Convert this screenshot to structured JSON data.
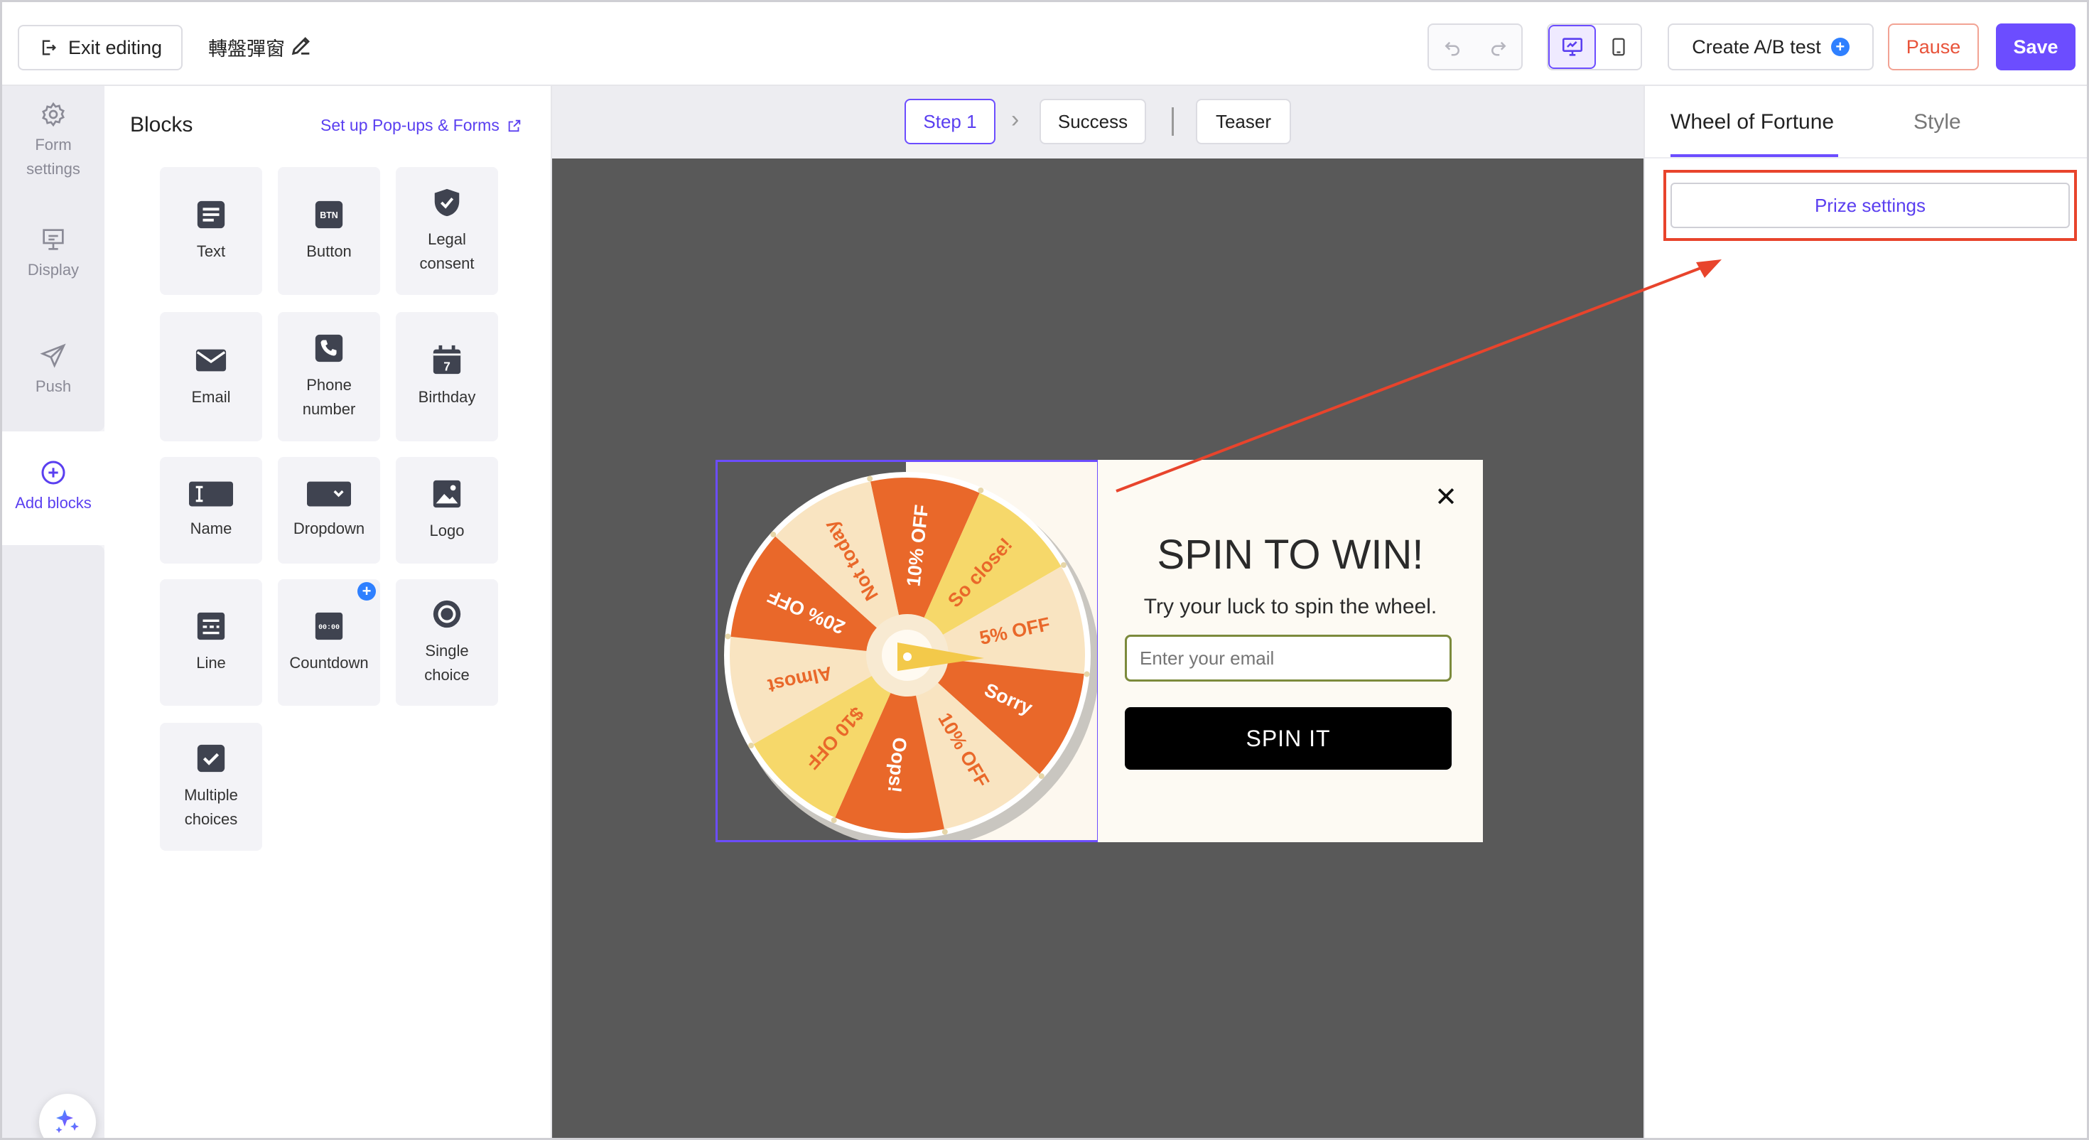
{
  "topbar": {
    "exit_label": "Exit editing",
    "form_name": "轉盤彈窗",
    "ab_test_label": "Create A/B test",
    "ab_plus": "+",
    "pause_label": "Pause",
    "save_label": "Save"
  },
  "rail": {
    "items": [
      {
        "label_line1": "Form",
        "label_line2": "settings",
        "icon": "gear-icon"
      },
      {
        "label": "Display",
        "icon": "display-icon"
      },
      {
        "label": "Push",
        "icon": "send-icon"
      },
      {
        "label": "Add blocks",
        "icon": "plus-circle-icon"
      }
    ]
  },
  "blocks": {
    "title": "Blocks",
    "setup_link": "Set up Pop-ups & Forms",
    "items": [
      {
        "label": "Text",
        "icon": "text-icon"
      },
      {
        "label": "Button",
        "icon": "button-icon",
        "icon_text": "BTN"
      },
      {
        "label_line1": "Legal",
        "label_line2": "consent",
        "icon": "shield-icon"
      },
      {
        "label": "Email",
        "icon": "email-icon"
      },
      {
        "label_line1": "Phone",
        "label_line2": "number",
        "icon": "phone-icon"
      },
      {
        "label": "Birthday",
        "icon": "calendar-icon",
        "icon_text": "7"
      },
      {
        "label": "Name",
        "icon": "name-icon"
      },
      {
        "label": "Dropdown",
        "icon": "dropdown-icon"
      },
      {
        "label": "Logo",
        "icon": "image-icon"
      },
      {
        "label": "Line",
        "icon": "line-icon"
      },
      {
        "label": "Countdown",
        "icon": "countdown-icon",
        "icon_text": "00:00",
        "badge": "+"
      },
      {
        "label_line1": "Single",
        "label_line2": "choice",
        "icon": "radio-icon"
      },
      {
        "label_line1": "Multiple",
        "label_line2": "choices",
        "icon": "checkbox-icon"
      }
    ]
  },
  "steps": {
    "step1": "Step 1",
    "chevron": "›",
    "success": "Success",
    "teaser": "Teaser"
  },
  "popup": {
    "title": "SPIN TO WIN!",
    "subtitle": "Try your luck to spin the wheel.",
    "email_placeholder": "Enter your email",
    "spin_label": "SPIN IT",
    "close": "✕",
    "segments": [
      "10% OFF",
      "So close!",
      "5% OFF",
      "Sorry",
      "10% OFF",
      "Oops!",
      "$10 OFF",
      "Almost",
      "20% OFF",
      "Not today"
    ]
  },
  "right_panel": {
    "tab_active": "Wheel of Fortune",
    "tab_style": "Style",
    "prize_settings": "Prize settings"
  },
  "colors": {
    "accent": "#6c4dff",
    "pause": "#e8533a",
    "annotation": "#e8442c",
    "wheel_orange": "#e9682a",
    "wheel_yellow": "#f6d86a",
    "wheel_cream": "#f9e4c1"
  }
}
